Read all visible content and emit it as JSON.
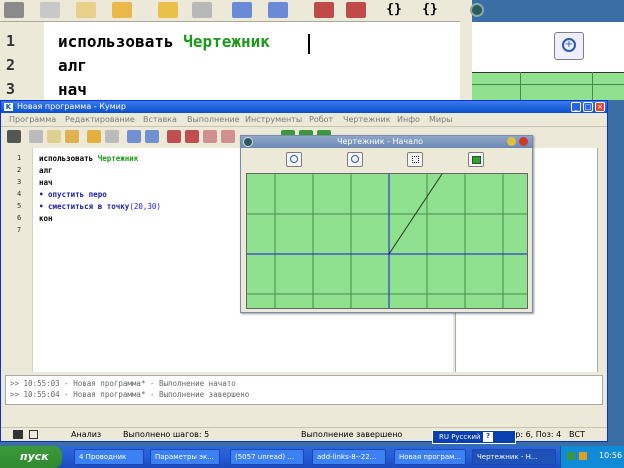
{
  "background_window": {
    "line_numbers": [
      "1",
      "2",
      "3"
    ],
    "code": [
      {
        "kw": "использовать",
        "name": "Чертежник"
      },
      {
        "kw": "алг",
        "name": ""
      },
      {
        "kw": "нач",
        "name": ""
      }
    ]
  },
  "main_window": {
    "title": "Новая программа - Кумир",
    "app_icon": "K",
    "controls": {
      "minimize": "_",
      "maximize": "□",
      "close": "×"
    },
    "menu": [
      "Программа",
      "Редактирование",
      "Вставка",
      "Выполнение",
      "Инструменты",
      "Робот",
      "Чертежник",
      "Инфо",
      "Миры"
    ],
    "line_numbers": [
      "1",
      "2",
      "3",
      "4",
      "5",
      "6",
      "7"
    ],
    "code": [
      {
        "kw": "использовать ",
        "name": "Чертежник",
        "args": ""
      },
      {
        "kw": "алг",
        "name": "",
        "args": ""
      },
      {
        "kw": "нач",
        "name": "",
        "args": ""
      },
      {
        "kw": "• опустить перо",
        "name": "",
        "args": ""
      },
      {
        "kw": "• сместиться в точку",
        "name": "",
        "args": "(20,30)"
      },
      {
        "kw": "кон",
        "name": "",
        "args": ""
      },
      {
        "kw": "",
        "name": "",
        "args": ""
      }
    ],
    "console": [
      ">> 10:55:03 - Новая программа* - Выполнение начато",
      ">> 10:55:04 - Новая программа* - Выполнение завершено"
    ],
    "status": {
      "mode": "Анализ",
      "steps": "Выполнено шагов: 5",
      "state": "Выполнение завершено",
      "position": "Стр: 6, Поз: 4",
      "insert": "ВСТ"
    }
  },
  "drawer_window": {
    "title": "Чертежник - Начало"
  },
  "language_bar": {
    "lang": "RU Русский",
    "help": "?"
  },
  "taskbar": {
    "start_label": "пуск",
    "tasks": [
      "4 Проводник",
      "Параметры эк...",
      "(5057 unread) ...",
      "add-links-8--22...",
      "Новая програм...",
      "Чертежник - Н..."
    ],
    "clock": "10:56"
  },
  "colors": {
    "keyword": "#000000",
    "name": "#1a9a1a",
    "args": "#1a1aff",
    "canvas": "#8fe08f",
    "axis": "#1a1add"
  }
}
